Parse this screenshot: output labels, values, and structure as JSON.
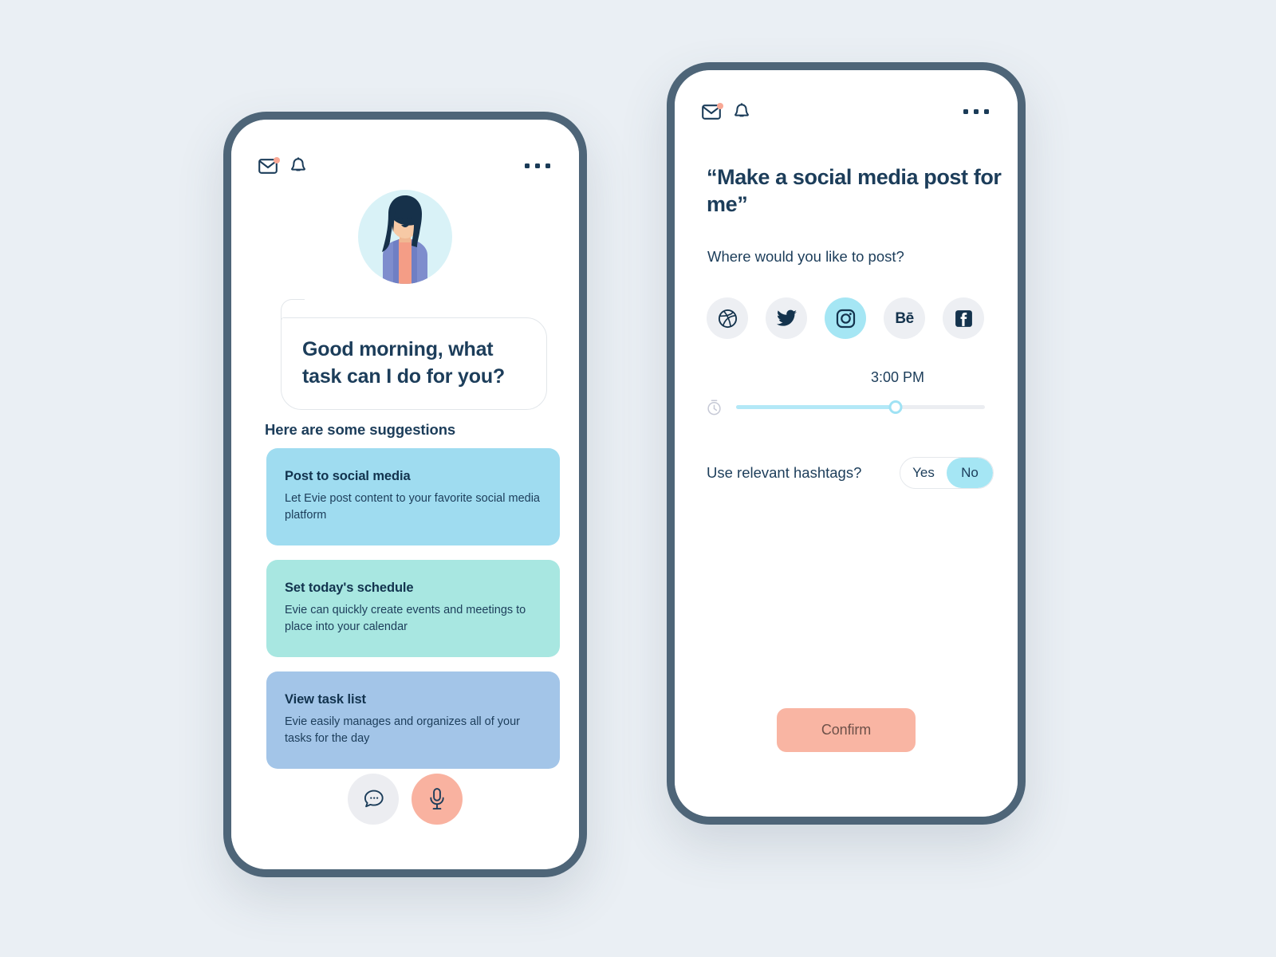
{
  "theme": {
    "page_background": "#eaeff4",
    "frame": "#4e6578",
    "ink": "#1c3d5a",
    "accent_coral": "#f9b5a3",
    "accent_cyan": "#a5e6f4"
  },
  "phone_one": {
    "name": "assistant-home-screen",
    "topbar": {
      "mail_icon": "mail-icon",
      "mail_badge": "unread-badge",
      "bell_icon": "bell-icon",
      "menu_icon": "more-options-icon"
    },
    "avatar": {
      "name": "assistant-avatar",
      "hair_color": "#16314a",
      "skin_color": "#f4c4a0",
      "shirt_color": "#f49d86",
      "cardigan_color": "#7e8dcd",
      "circle_background": "#d9f2f7"
    },
    "greeting": "Good morning, what task can I do for you?",
    "suggestions_heading": "Here are some suggestions",
    "suggestions": [
      {
        "title": "Post to social media",
        "description": "Let Evie post content to your favorite social media platform",
        "color": "#9fdcf0"
      },
      {
        "title": "Set today's schedule",
        "description": "Evie can quickly create events and meetings to place into your calendar",
        "color": "#a8e7e1"
      },
      {
        "title": "View task list",
        "description": "Evie easily manages and organizes all of your tasks for the day",
        "color": "#a3c5e8"
      }
    ],
    "actions": [
      {
        "name": "chat-button",
        "icon": "chat-bubble-icon",
        "background": "#ecedf1"
      },
      {
        "name": "voice-button",
        "icon": "microphone-icon",
        "background": "#f9b2a0"
      }
    ]
  },
  "phone_two": {
    "name": "social-post-setup-screen",
    "topbar": {
      "mail_icon": "mail-icon",
      "bell_icon": "bell-icon",
      "menu_icon": "more-options-icon"
    },
    "title": "“Make a social media post for me”",
    "question": "Where would you like to post?",
    "platforms": [
      {
        "name": "dribbble",
        "label": "Dribbble",
        "selected": false
      },
      {
        "name": "twitter",
        "label": "Twitter",
        "selected": false
      },
      {
        "name": "instagram",
        "label": "Instagram",
        "selected": true
      },
      {
        "name": "behance",
        "label": "Behance",
        "glyph": "Bē",
        "selected": false
      },
      {
        "name": "facebook",
        "label": "Facebook",
        "glyph": "f",
        "selected": false
      }
    ],
    "time_slider": {
      "icon": "stopwatch-icon",
      "value": "3:00 PM",
      "fill_percent": 64
    },
    "hashtags": {
      "label": "Use relevant hashtags?",
      "options": [
        "Yes",
        "No"
      ],
      "selected": "No"
    },
    "confirm_label": "Confirm"
  }
}
